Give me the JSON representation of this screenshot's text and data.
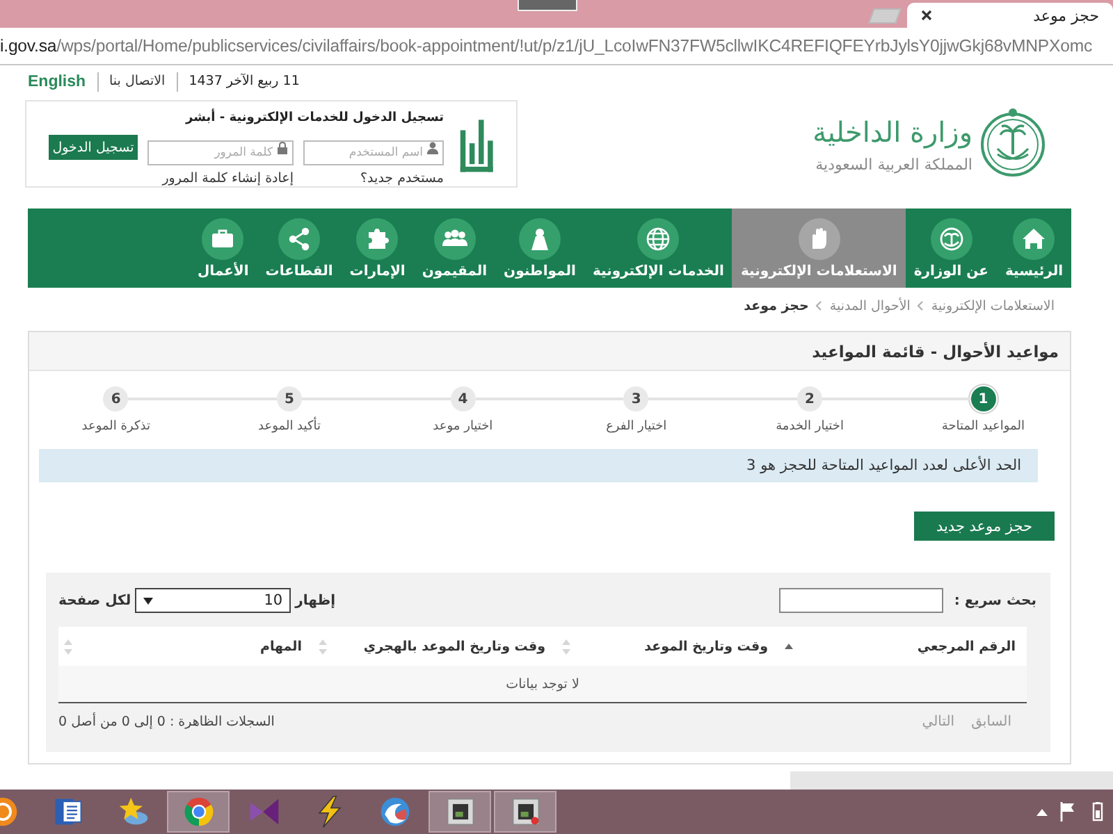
{
  "browser": {
    "tab_title": "حجز موعد",
    "address_host": "i.gov.sa",
    "address_path": "/wps/portal/Home/publicservices/civilaffairs/book-appointment/!ut/p/z1/jU_LcoIwFN37FW5cllwIKC4REFIQFEYrbJylsY0jjwGkj68vMNPXomc"
  },
  "utility_links": [
    {
      "kind": "date",
      "text": "11 ربيع الآخر 1437"
    },
    {
      "kind": "link",
      "text": "الاتصال بنا"
    },
    {
      "kind": "language",
      "text": "English"
    }
  ],
  "ministry": {
    "name": "وزارة الداخلية",
    "country": "المملكة العربية السعودية"
  },
  "login": {
    "title": "تسجيل الدخول للخدمات الإلكترونية - أبشر",
    "username_placeholder": "اسم المستخدم",
    "password_placeholder": "كلمة المرور",
    "submit": "تسجيل الدخول",
    "new_user": "مستخدم جديد؟",
    "reset_password": "إعادة إنشاء كلمة المرور"
  },
  "nav": [
    {
      "label": "الرئيسية",
      "selected": false
    },
    {
      "label": "عن الوزارة",
      "selected": false
    },
    {
      "label": "الاستعلامات الإلكترونية",
      "selected": true
    },
    {
      "label": "الخدمات الإلكترونية",
      "selected": false
    },
    {
      "label": "المواطنون",
      "selected": false
    },
    {
      "label": "المقيمون",
      "selected": false
    },
    {
      "label": "الإمارات",
      "selected": false
    },
    {
      "label": "القطاعات",
      "selected": false
    },
    {
      "label": "الأعمال",
      "selected": false
    }
  ],
  "breadcrumb": [
    {
      "text": "الاستعلامات الإلكترونية",
      "current": false
    },
    {
      "text": "الأحوال المدنية",
      "current": false
    },
    {
      "text": "حجز موعد",
      "current": true
    }
  ],
  "panel": {
    "title": "مواعيد الأحوال - قائمة المواعيد",
    "steps": [
      {
        "number": "1",
        "label": "المواعيد المتاحة",
        "active": true
      },
      {
        "number": "2",
        "label": "اختيار الخدمة",
        "active": false
      },
      {
        "number": "3",
        "label": "اختيار الفرع",
        "active": false
      },
      {
        "number": "4",
        "label": "اختيار موعد",
        "active": false
      },
      {
        "number": "5",
        "label": "تأكيد الموعد",
        "active": false
      },
      {
        "number": "6",
        "label": "تذكرة الموعد",
        "active": false
      }
    ],
    "notice": "الحد الأعلى لعدد المواعيد المتاحة للحجز هو 3",
    "new_button": "حجز موعد جديد"
  },
  "table": {
    "search_label": "بحث سريع :",
    "show_label": "إظهار",
    "page_size": "10",
    "per_page_label": "لكل صفحة",
    "columns": [
      {
        "label": "الرقم المرجعي",
        "sorted_ascending": true
      },
      {
        "label": "وقت وتاريخ الموعد",
        "sorted_ascending": false
      },
      {
        "label": "وقت وتاريخ الموعد بالهجري",
        "sorted_ascending": false
      },
      {
        "label": "المهام",
        "sorted_ascending": false
      }
    ],
    "empty_text": "لا توجد بيانات",
    "info": "السجلات الظاهرة : 0 إلى 0 من أصل 0",
    "pagination": [
      {
        "label": "السابق",
        "disabled": true
      },
      {
        "label": "التالي",
        "disabled": true
      }
    ]
  },
  "taskbar": {
    "items": [
      {
        "open": false
      },
      {
        "open": false
      },
      {
        "open": false
      },
      {
        "open": true
      },
      {
        "open": false
      },
      {
        "open": false
      },
      {
        "open": false
      },
      {
        "open": true
      },
      {
        "open": true
      }
    ]
  }
}
